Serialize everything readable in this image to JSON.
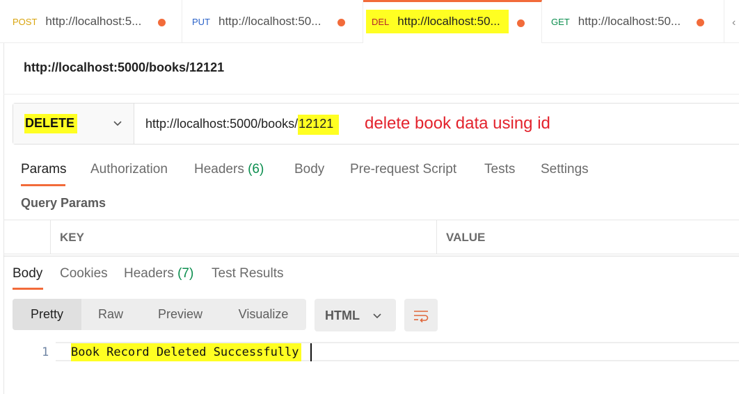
{
  "tabs": [
    {
      "method": "POST",
      "method_color": "#d9a40d",
      "url": "http://localhost:5..."
    },
    {
      "method": "PUT",
      "method_color": "#2a62c9",
      "url": "http://localhost:50..."
    },
    {
      "method": "DEL",
      "method_color": "#b3262d",
      "url": "http://localhost:50...",
      "active": true
    },
    {
      "method": "GET",
      "method_color": "#0b8e4e",
      "url": "http://localhost:50..."
    }
  ],
  "tab_overflow": "‹",
  "request_title": "http://localhost:5000/books/12121",
  "request": {
    "method": "DELETE",
    "url_base": "http://localhost:5000/books/",
    "url_id": "12121",
    "annotation": "delete book data using id"
  },
  "request_tabs": {
    "params": "Params",
    "authorization": "Authorization",
    "headers": "Headers",
    "headers_count": "(6)",
    "body": "Body",
    "prerequest": "Pre-request Script",
    "tests": "Tests",
    "settings": "Settings"
  },
  "query_params": {
    "label": "Query Params",
    "key_header": "KEY",
    "value_header": "VALUE"
  },
  "response_tabs": {
    "body": "Body",
    "cookies": "Cookies",
    "headers": "Headers",
    "headers_count": "(7)",
    "test_results": "Test Results"
  },
  "view_modes": {
    "pretty": "Pretty",
    "raw": "Raw",
    "preview": "Preview",
    "visualize": "Visualize"
  },
  "format": "HTML",
  "response": {
    "line_number": "1",
    "text": "Book Record Deleted Successfully"
  },
  "colors": {
    "accent": "#f26b3a",
    "highlight": "#ffff22",
    "annotation": "#e3232d",
    "count_green": "#0b8e4e"
  }
}
